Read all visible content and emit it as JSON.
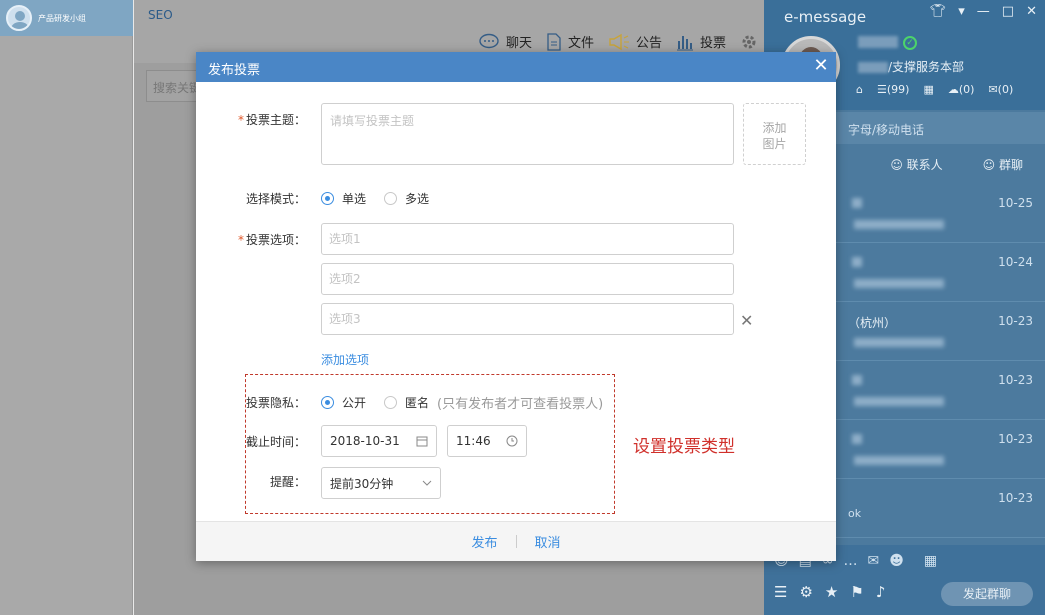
{
  "left_panel": {
    "group_name": "产品研发小组"
  },
  "chat": {
    "title": "SEO",
    "search_placeholder": "搜索关键",
    "toolbar": [
      {
        "icon": "chat-bubble-icon",
        "label": "聊天"
      },
      {
        "icon": "file-icon",
        "label": "文件"
      },
      {
        "icon": "megaphone-icon",
        "label": "公告"
      },
      {
        "icon": "vote-bars-icon",
        "label": "投票"
      }
    ]
  },
  "right_panel": {
    "app_title": "e-message",
    "dept": "/支撑服务本部",
    "quick": {
      "tasks": "(99)",
      "cloud": "(0)",
      "mail": "(0)"
    },
    "search_hint": "字母/移动电话",
    "tabs": [
      "联系人",
      "群聊"
    ],
    "conversations": [
      {
        "date": "10-25",
        "name": "",
        "msg": ""
      },
      {
        "date": "10-24",
        "name": "",
        "msg": ""
      },
      {
        "date": "10-23",
        "name": "（杭州）",
        "msg": ""
      },
      {
        "date": "10-23",
        "name": "",
        "msg": ""
      },
      {
        "date": "10-23",
        "name": "",
        "msg": ""
      },
      {
        "date": "10-23",
        "name": "",
        "msg": "ok"
      }
    ],
    "start_group": "发起群聊"
  },
  "modal": {
    "title": "发布投票",
    "topic": {
      "label": "投票主题：",
      "placeholder": "请填写投票主题"
    },
    "add_image": [
      "添加",
      "图片"
    ],
    "mode": {
      "label": "选择模式：",
      "options": [
        "单选",
        "多选"
      ],
      "selected": "单选"
    },
    "options": {
      "label": "投票选项：",
      "placeholders": [
        "选项1",
        "选项2",
        "选项3"
      ]
    },
    "add_option": "添加选项",
    "privacy": {
      "label": "投票隐私：",
      "options": [
        "公开",
        "匿名"
      ],
      "hint": "(只有发布者才可查看投票人)",
      "selected": "公开"
    },
    "deadline": {
      "label": "截止时间：",
      "date": "2018-10-31",
      "time": "11:46"
    },
    "reminder": {
      "label": "提醒：",
      "value": "提前30分钟"
    },
    "annotation": "设置投票类型",
    "publish": "发布",
    "cancel": "取消"
  }
}
